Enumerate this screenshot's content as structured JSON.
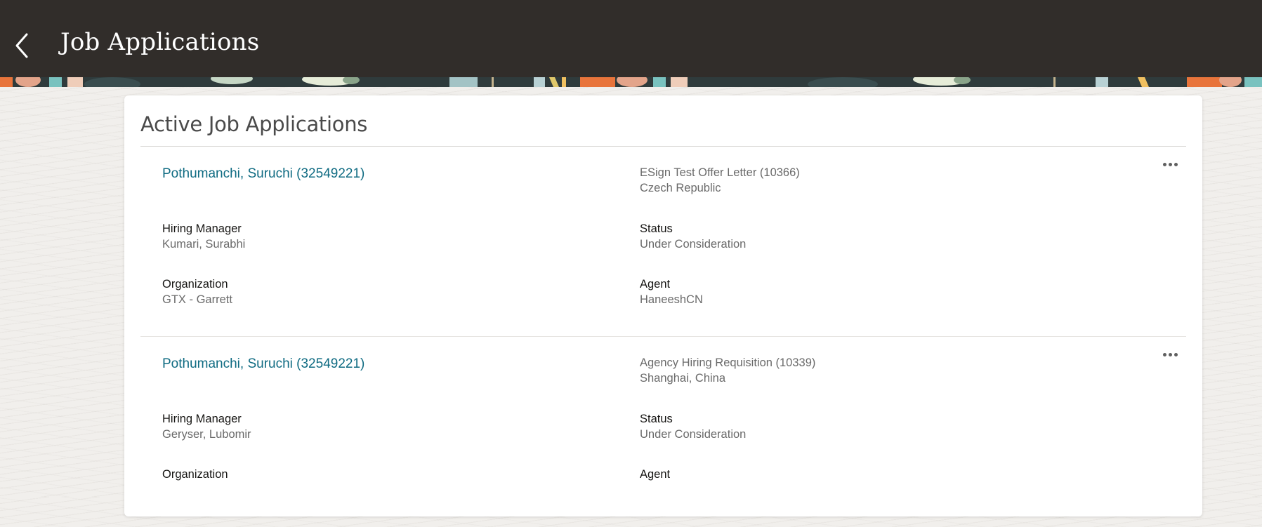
{
  "header": {
    "title": "Job Applications",
    "back_icon": "chevron-left-icon"
  },
  "section": {
    "title": "Active Job Applications"
  },
  "applications": [
    {
      "candidate": "Pothumanchi, Suruchi (32549221)",
      "requisition": "ESign Test Offer Letter (10366)",
      "location": "Czech Republic",
      "hiring_manager_label": "Hiring Manager",
      "hiring_manager": "Kumari, Surabhi",
      "status_label": "Status",
      "status": "Under Consideration",
      "organization_label": "Organization",
      "organization": "GTX - Garrett",
      "agent_label": "Agent",
      "agent": "HaneeshCN"
    },
    {
      "candidate": "Pothumanchi, Suruchi (32549221)",
      "requisition": "Agency Hiring Requisition (10339)",
      "location": "Shanghai, China",
      "hiring_manager_label": "Hiring Manager",
      "hiring_manager": "Geryser, Lubomir",
      "status_label": "Status",
      "status": "Under Consideration",
      "organization_label": "Organization",
      "organization": "",
      "agent_label": "Agent",
      "agent": ""
    }
  ],
  "colors": {
    "header_bg": "#312d2a",
    "link": "#0f6b82",
    "page_bg": "#f1efec"
  }
}
